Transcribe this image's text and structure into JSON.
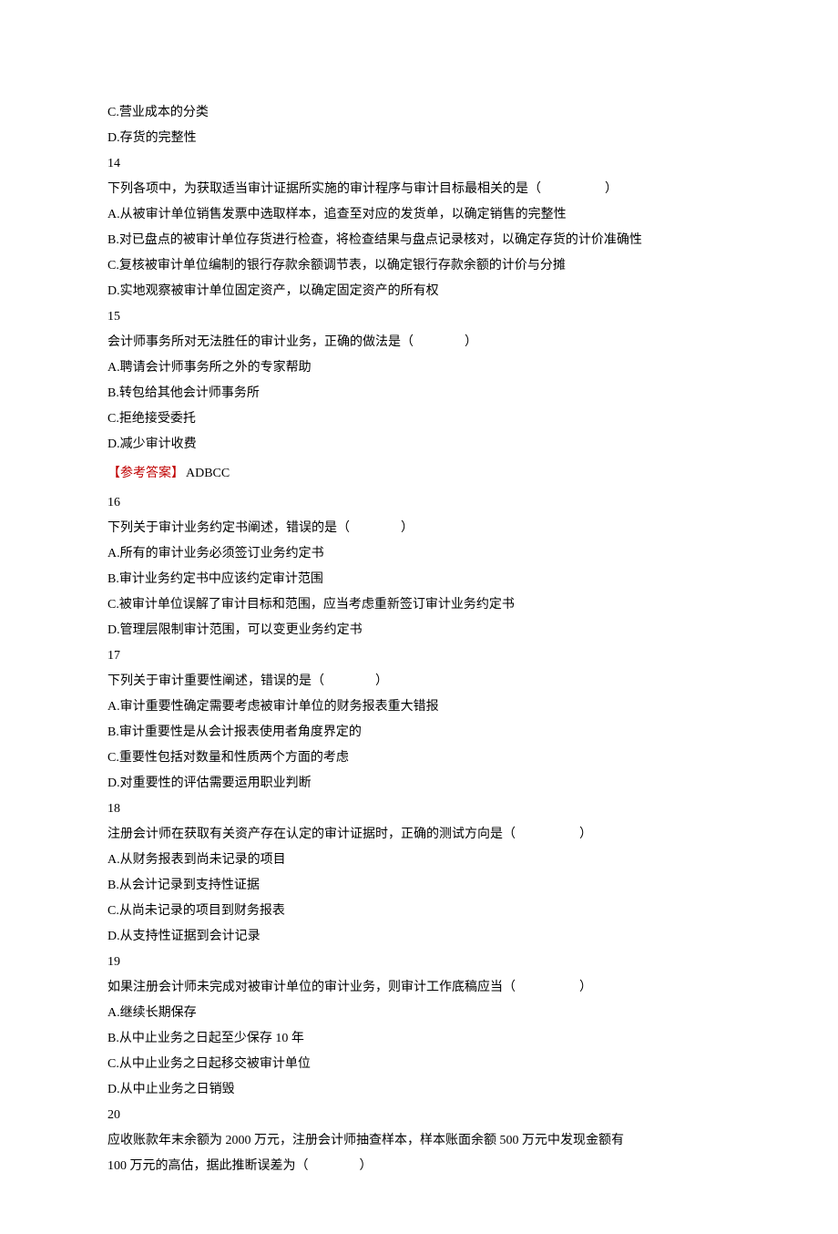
{
  "q13": {
    "optC": "C.营业成本的分类",
    "optD": "D.存货的完整性"
  },
  "q14": {
    "num": "14",
    "stem": "下列各项中，为获取适当审计证据所实施的审计程序与审计目标最相关的是（　　　　　）",
    "optA": "A.从被审计单位销售发票中选取样本，追查至对应的发货单，以确定销售的完整性",
    "optB": "B.对已盘点的被审计单位存货进行检查，将检查结果与盘点记录核对，以确定存货的计价准确性",
    "optC": "C.复核被审计单位编制的银行存款余额调节表，以确定银行存款余额的计价与分摊",
    "optD": "D.实地观察被审计单位固定资产，以确定固定资产的所有权"
  },
  "q15": {
    "num": "15",
    "stem": "会计师事务所对无法胜任的审计业务，正确的做法是（　　　　）",
    "optA": "A.聘请会计师事务所之外的专家帮助",
    "optB": "B.转包给其他会计师事务所",
    "optC": "C.拒绝接受委托",
    "optD": "D.减少审计收费"
  },
  "answer1": {
    "label": "【参考答案】",
    "key": "ADBCC"
  },
  "q16": {
    "num": "16",
    "stem": "下列关于审计业务约定书阐述，错误的是（　　　　）",
    "optA": "A.所有的审计业务必须签订业务约定书",
    "optB": "B.审计业务约定书中应该约定审计范围",
    "optC": "C.被审计单位误解了审计目标和范围，应当考虑重新签订审计业务约定书",
    "optD": "D.管理层限制审计范围，可以变更业务约定书"
  },
  "q17": {
    "num": "17",
    "stem": "下列关于审计重要性阐述，错误的是（　　　　）",
    "optA": "A.审计重要性确定需要考虑被审计单位的财务报表重大错报",
    "optB": "B.审计重要性是从会计报表使用者角度界定的",
    "optC": "C.重要性包括对数量和性质两个方面的考虑",
    "optD": "D.对重要性的评估需要运用职业判断"
  },
  "q18": {
    "num": "18",
    "stem": "注册会计师在获取有关资产存在认定的审计证据时，正确的测试方向是（　　　　　）",
    "optA": "A.从财务报表到尚未记录的项目",
    "optB": "B.从会计记录到支持性证据",
    "optC": "C.从尚未记录的项目到财务报表",
    "optD": "D.从支持性证据到会计记录"
  },
  "q19": {
    "num": "19",
    "stem": "如果注册会计师未完成对被审计单位的审计业务，则审计工作底稿应当（　　　　　）",
    "optA": "A.继续长期保存",
    "optB": "B.从中止业务之日起至少保存 10 年",
    "optC": "C.从中止业务之日起移交被审计单位",
    "optD": "D.从中止业务之日销毁"
  },
  "q20": {
    "num": "20",
    "stem1": "应收账款年末余额为 2000 万元，注册会计师抽查样本，样本账面余额 500 万元中发现金额有",
    "stem2": "100 万元的高估，据此推断误差为（　　　　）"
  }
}
